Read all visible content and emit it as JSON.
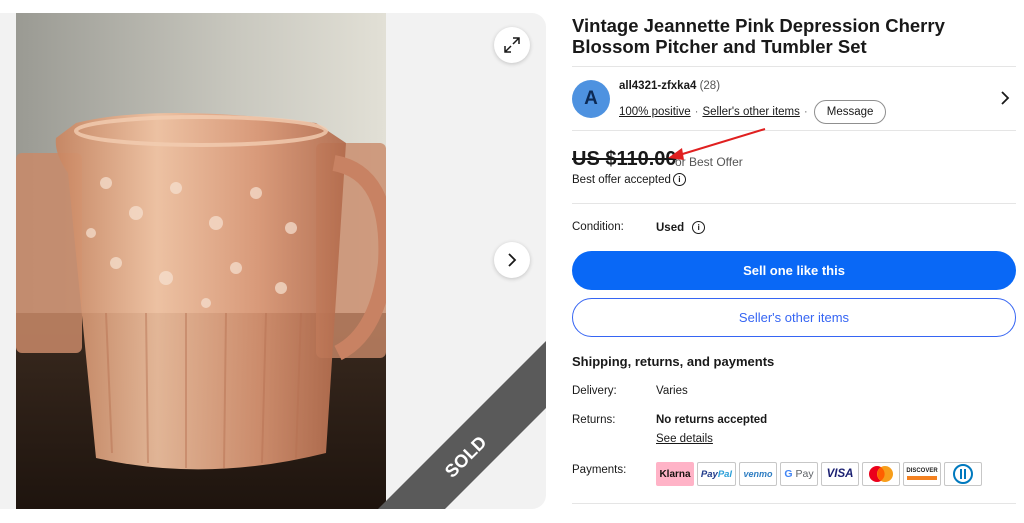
{
  "listing": {
    "title": "Vintage Jeannette Pink Depression Cherry Blossom Pitcher and Tumbler Set",
    "sold_ribbon": "SOLD"
  },
  "seller": {
    "avatar_letter": "A",
    "name": "all4321-zfxka4",
    "feedback_count": "(28)",
    "positive": "100% positive",
    "other_items_link": "Seller's other items",
    "message_button": "Message"
  },
  "price": {
    "amount": "US $110.00",
    "offer_tag": "or Best Offer",
    "best_offer_accepted": "Best offer accepted"
  },
  "condition": {
    "label": "Condition:",
    "value": "Used"
  },
  "buttons": {
    "sell_one": "Sell one like this",
    "seller_other_items": "Seller's other items"
  },
  "shipping": {
    "heading": "Shipping, returns, and payments",
    "delivery_label": "Delivery:",
    "delivery_value": "Varies",
    "returns_label": "Returns:",
    "returns_value": "No returns accepted",
    "see_details": "See details",
    "payments_label": "Payments:"
  },
  "payments": {
    "klarna": "Klarna",
    "paypal_pay": "Pay",
    "paypal_pal": "Pal",
    "venmo": "venmo",
    "gpay_g": "G",
    "gpay_pay": "Pay",
    "visa": "VISA",
    "discover": "DISCOVER"
  },
  "colors": {
    "primary_blue": "#0968f6",
    "link_blue": "#3665f3",
    "annotation_red": "#e02020",
    "ribbon_gray": "#5a5a5a"
  }
}
